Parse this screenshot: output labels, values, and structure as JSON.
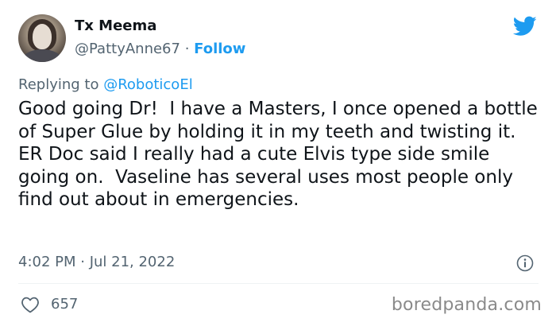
{
  "author": {
    "display_name": "Tx Meema",
    "handle": "@PattyAnne67",
    "separator": "·",
    "follow_label": "Follow"
  },
  "reply": {
    "prefix": "Replying to ",
    "mention": "@RoboticoEl"
  },
  "tweet": {
    "text": "Good going Dr!  I have a Masters, I once opened a bottle of Super Glue by holding it in my teeth and twisting it. ER Doc said I really had a cute Elvis type side smile  going on.  Vaseline has several uses most people only find out about in emergencies.",
    "timestamp": "4:02 PM · Jul 21, 2022"
  },
  "engagement": {
    "like_count": "657"
  },
  "watermark": "boredpanda.com",
  "icons": {
    "brand": "twitter-bird-icon",
    "info": "info-icon",
    "like": "heart-icon"
  },
  "colors": {
    "accent": "#1d9bf0",
    "secondary_text": "#536471",
    "primary_text": "#0f1419"
  }
}
